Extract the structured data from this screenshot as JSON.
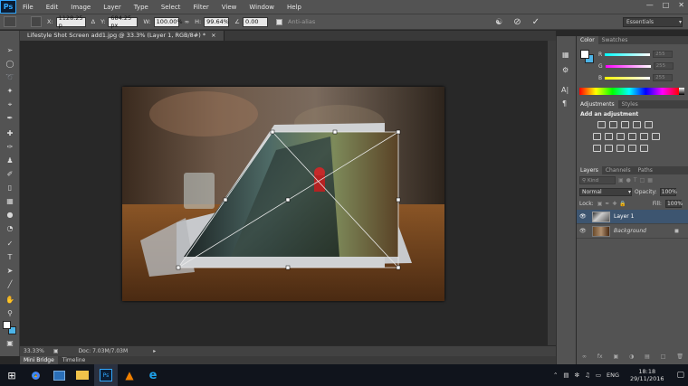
{
  "menubar": {
    "logo": "Ps",
    "items": [
      "File",
      "Edit",
      "Image",
      "Layer",
      "Type",
      "Select",
      "Filter",
      "View",
      "Window",
      "Help"
    ]
  },
  "options": {
    "x_label": "X:",
    "x_value": "1128.25 p",
    "y_label": "Y:",
    "y_value": "684.25 px",
    "w_label": "W:",
    "w_value": "100.00%",
    "h_label": "H:",
    "h_value": "99.64%",
    "angle_value": "0.00",
    "antialias_label": "Anti-alias",
    "workspace": "Essentials"
  },
  "document": {
    "tab_title": "Lifestyle Shot Screen add1.jpg @ 33.3% (Layer 1, RGB/8#) *",
    "zoom": "33.33%",
    "doc_info": "Doc: 7.03M/7.03M"
  },
  "bottom_tabs": [
    "Mini Bridge",
    "Timeline"
  ],
  "color_panel": {
    "tabs": [
      "Color",
      "Swatches"
    ],
    "r_label": "R",
    "g_label": "G",
    "b_label": "B",
    "r_value": "255",
    "g_value": "255",
    "b_value": "255"
  },
  "adjustments_panel": {
    "tabs": [
      "Adjustments",
      "Styles"
    ],
    "heading": "Add an adjustment"
  },
  "layers_panel": {
    "tabs": [
      "Layers",
      "Channels",
      "Paths"
    ],
    "kind_label": "Kind",
    "blend_mode": "Normal",
    "opacity_label": "Opacity:",
    "opacity_value": "100%",
    "lock_label": "Lock:",
    "fill_label": "Fill:",
    "fill_value": "100%",
    "layers": [
      {
        "name": "Layer 1"
      },
      {
        "name": "Background"
      }
    ]
  },
  "taskbar": {
    "language": "ENG",
    "time": "18:18",
    "date": "29/11/2016"
  },
  "colors": {
    "ui_bg": "#535353",
    "canvas_bg": "#282828",
    "selection": "#3d5570",
    "brand": "#31a8ff"
  }
}
